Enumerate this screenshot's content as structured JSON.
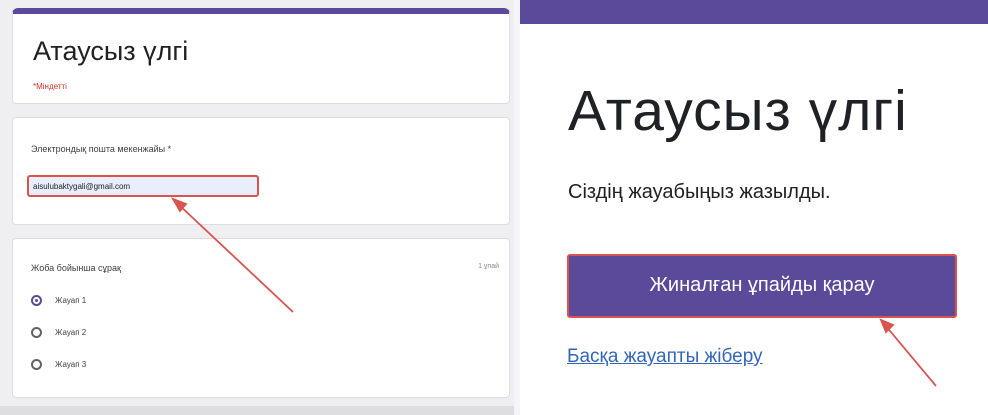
{
  "left_form": {
    "title": "Атаусыз үлгі",
    "required_note": "*Міндетті",
    "email": {
      "label": "Электрондық пошта мекенжайы *",
      "value": "aisulubaktygali@gmail.com"
    },
    "question": {
      "title": "Жоба бойынша сұрақ",
      "points": "1 ұпай",
      "options": [
        {
          "label": "Жауап 1",
          "selected": true
        },
        {
          "label": "Жауап 2",
          "selected": false
        },
        {
          "label": "Жауап 3",
          "selected": false
        }
      ]
    }
  },
  "confirmation": {
    "title": "Атаусыз үлгі",
    "message": "Сіздің жауабыңыз жазылды.",
    "view_score_button": "Жиналған ұпайды қарау",
    "submit_another_link": "Басқа жауапты жіберу"
  },
  "colors": {
    "accent": "#5b4a9a",
    "highlight": "#d9534f",
    "link": "#3366bb"
  }
}
